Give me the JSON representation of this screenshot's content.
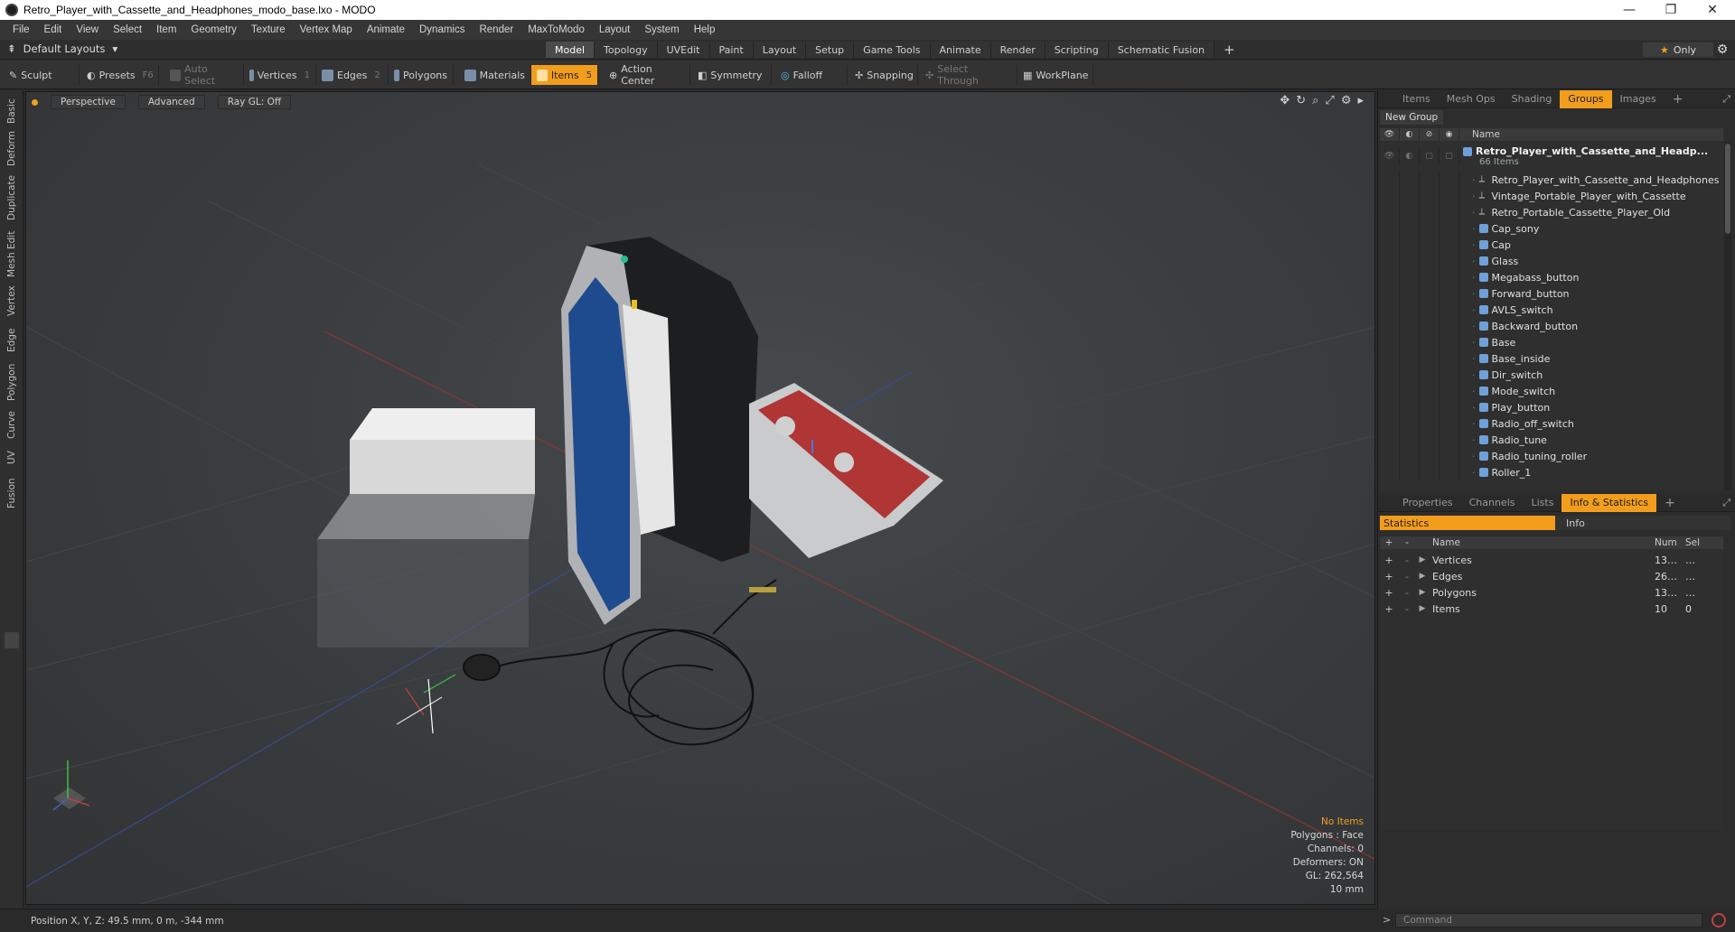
{
  "window": {
    "title": "Retro_Player_with_Cassette_and_Headphones_modo_base.lxo - MODO",
    "minimize": "—",
    "maximize": "❐",
    "close": "✕"
  },
  "menu": [
    "File",
    "Edit",
    "View",
    "Select",
    "Item",
    "Geometry",
    "Texture",
    "Vertex Map",
    "Animate",
    "Dynamics",
    "Render",
    "MaxToModo",
    "Layout",
    "System",
    "Help"
  ],
  "layout": {
    "selector": "Default Layouts",
    "tabs": [
      "Model",
      "Topology",
      "UVEdit",
      "Paint",
      "Layout",
      "Setup",
      "Game Tools",
      "Animate",
      "Render",
      "Scripting",
      "Schematic Fusion"
    ],
    "active_tab": "Model",
    "only_label": "Only"
  },
  "toolbar": {
    "sculpt": "Sculpt",
    "presets": "Presets",
    "presets_key": "F6",
    "auto_select": "Auto Select",
    "vertices": "Vertices",
    "vertices_key": "1",
    "edges": "Edges",
    "edges_key": "2",
    "polygons": "Polygons",
    "materials": "Materials",
    "items": "Items",
    "items_key": "5",
    "action_center": "Action Center",
    "symmetry": "Symmetry",
    "falloff": "Falloff",
    "snapping": "Snapping",
    "select_through": "Select Through",
    "workplane": "WorkPlane"
  },
  "left_tabs": [
    "Basic",
    "Deform",
    "Duplicate",
    "Mesh Edit",
    "Vertex",
    "Edge",
    "Polygon",
    "Curve",
    "UV",
    "Fusion"
  ],
  "viewport": {
    "perspective": "Perspective",
    "advanced": "Advanced",
    "raygl": "Ray GL: Off",
    "stats": {
      "no_items": "No Items",
      "polygons": "Polygons : Face",
      "channels": "Channels: 0",
      "deformers": "Deformers: ON",
      "gl": "GL: 262,564",
      "scale": "10 mm"
    }
  },
  "status": {
    "position": "Position X, Y, Z:  49.5 mm, 0 m, -344 mm"
  },
  "right_top": {
    "tabs": [
      "Items",
      "Mesh Ops",
      "Shading",
      "Groups",
      "Images"
    ],
    "active": "Groups",
    "new_group": "New Group",
    "col_name": "Name",
    "root": {
      "name": "Retro_Player_with_Cassette_and_Headp...",
      "count": "66 Items"
    },
    "items": [
      {
        "name": "Retro_Player_with_Cassette_and_Headphones",
        "type": "locator"
      },
      {
        "name": "Vintage_Portable_Player_with_Cassette",
        "type": "locator"
      },
      {
        "name": "Retro_Portable_Cassette_Player_Old",
        "type": "locator"
      },
      {
        "name": "Cap_sony",
        "type": "mesh"
      },
      {
        "name": "Cap",
        "type": "mesh"
      },
      {
        "name": "Glass",
        "type": "mesh"
      },
      {
        "name": "Megabass_button",
        "type": "mesh"
      },
      {
        "name": "Forward_button",
        "type": "mesh"
      },
      {
        "name": "AVLS_switch",
        "type": "mesh"
      },
      {
        "name": "Backward_button",
        "type": "mesh"
      },
      {
        "name": "Base",
        "type": "mesh"
      },
      {
        "name": "Base_inside",
        "type": "mesh"
      },
      {
        "name": "Dir_switch",
        "type": "mesh"
      },
      {
        "name": "Mode_switch",
        "type": "mesh"
      },
      {
        "name": "Play_button",
        "type": "mesh"
      },
      {
        "name": "Radio_off_switch",
        "type": "mesh"
      },
      {
        "name": "Radio_tune",
        "type": "mesh"
      },
      {
        "name": "Radio_tuning_roller",
        "type": "mesh"
      },
      {
        "name": "Roller_1",
        "type": "mesh"
      }
    ]
  },
  "right_bottom": {
    "tabs": [
      "Properties",
      "Channels",
      "Lists",
      "Info & Statistics"
    ],
    "active": "Info & Statistics",
    "sub_statistics": "Statistics",
    "sub_info": "Info",
    "col_name": "Name",
    "col_num": "Num",
    "col_sel": "Sel",
    "rows": [
      {
        "label": "Vertices",
        "num": "13…",
        "sel": "…"
      },
      {
        "label": "Edges",
        "num": "26…",
        "sel": "…"
      },
      {
        "label": "Polygons",
        "num": "13…",
        "sel": "…"
      },
      {
        "label": "Items",
        "num": "10",
        "sel": "0"
      }
    ]
  },
  "command": {
    "placeholder": "Command"
  },
  "colors": {
    "accent": "#f29d1c",
    "background": "#2b2b2b"
  }
}
